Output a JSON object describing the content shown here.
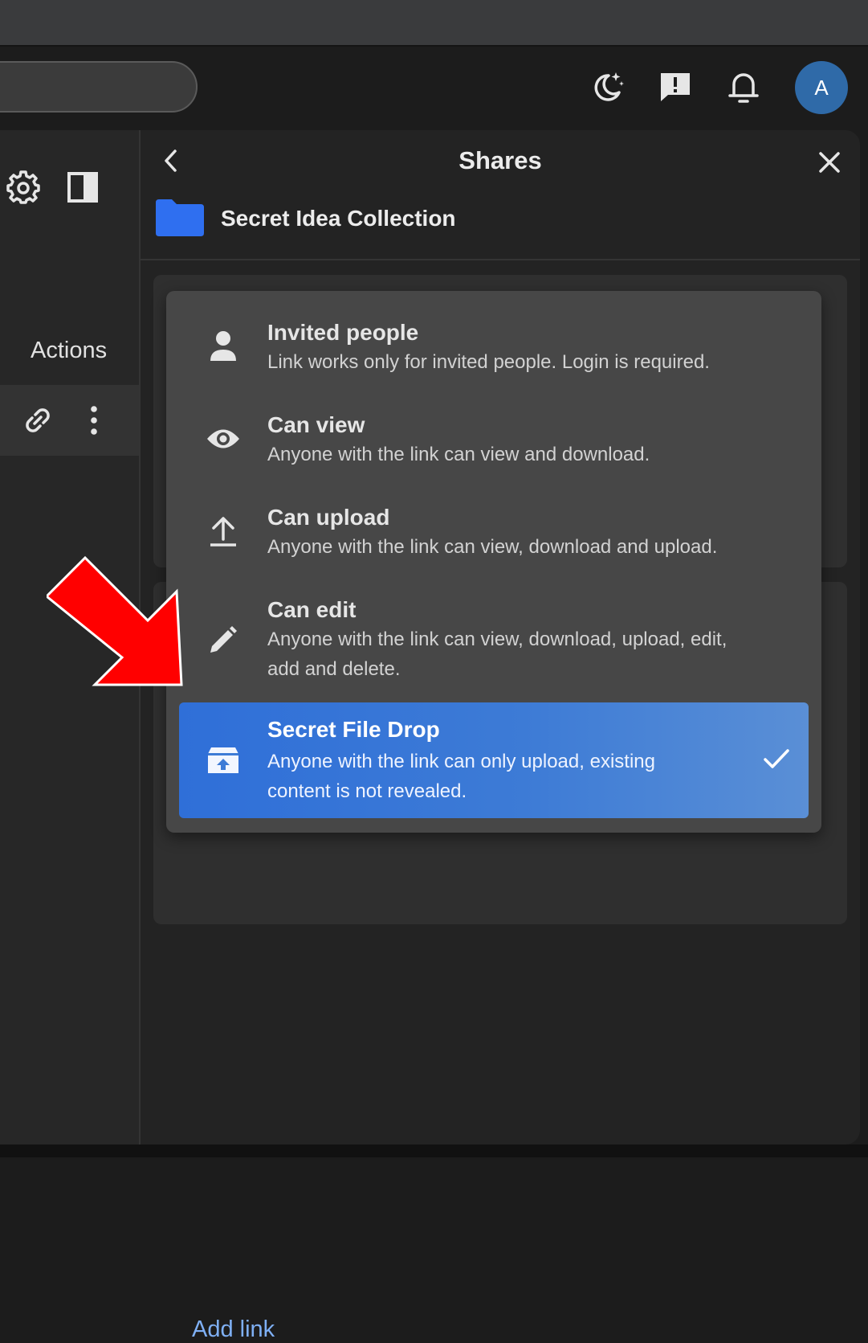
{
  "header": {
    "icons": [
      "moon-sparkle-icon",
      "feedback-icon",
      "bell-icon"
    ],
    "avatar_letter": "A"
  },
  "left_panel": {
    "actions_label": "Actions"
  },
  "share_panel": {
    "title": "Shares",
    "folder_name": "Secret Idea Collection",
    "add_link_label": "Add link"
  },
  "permission_menu": {
    "options": [
      {
        "title": "Invited people",
        "description": "Link works only for invited people. Login is required.",
        "icon": "person-icon",
        "selected": false
      },
      {
        "title": "Can view",
        "description": "Anyone with the link can view and download.",
        "icon": "eye-icon",
        "selected": false
      },
      {
        "title": "Can upload",
        "description": "Anyone with the link can view, download and upload.",
        "icon": "upload-icon",
        "selected": false
      },
      {
        "title": "Can edit",
        "description": "Anyone with the link can view, download, upload, edit, add and delete.",
        "icon": "pencil-icon",
        "selected": false
      },
      {
        "title": "Secret File Drop",
        "description": "Anyone with the link can only upload, existing content is not revealed.",
        "icon": "file-drop-icon",
        "selected": true
      }
    ]
  },
  "colors": {
    "accent": "#3373d8",
    "annotation_arrow": "#ff0000",
    "link": "#7fb0f5"
  }
}
